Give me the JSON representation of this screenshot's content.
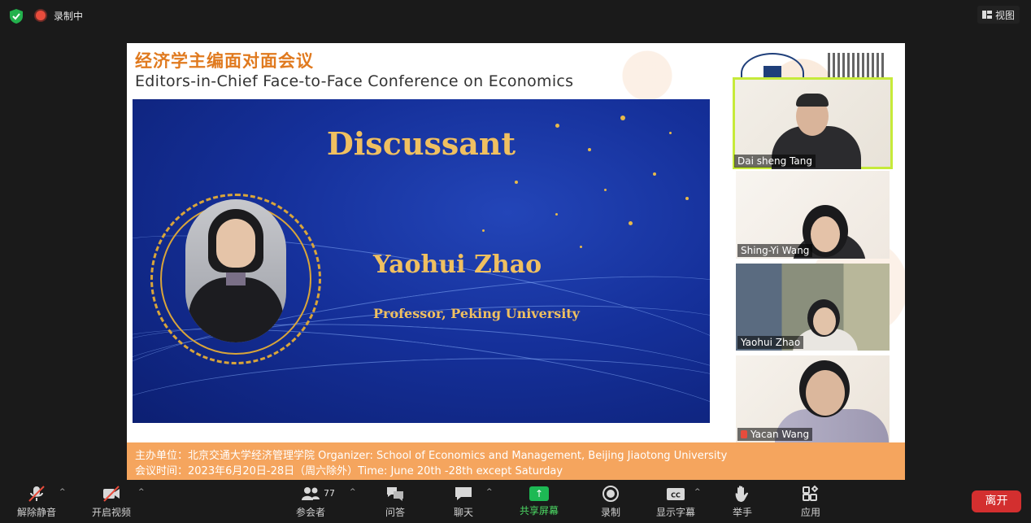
{
  "status": {
    "recording_label": "录制中",
    "view_label": "视图"
  },
  "slide": {
    "title_cn": "经济学主编面对面会议",
    "title_en": "Editors-in-Chief Face-to-Face Conference on Economics",
    "heading": "Discussant",
    "speaker_name": "Yaohui Zhao",
    "speaker_affiliation": "Professor, Peking University",
    "footer_line1": "主办单位：北京交通大学经济管理学院 Organizer: School of Economics and Management, Beijing Jiaotong University",
    "footer_line2": "会议时间：2023年6月20日-28日（周六除外）Time: June 20th -28th except Saturday"
  },
  "participants": [
    {
      "name": "Dai sheng Tang",
      "active": true,
      "muted": false
    },
    {
      "name": "Shing-Yi Wang",
      "active": false,
      "muted": false
    },
    {
      "name": "Yaohui Zhao",
      "active": false,
      "muted": false
    },
    {
      "name": "Yacan Wang",
      "active": false,
      "muted": true
    }
  ],
  "toolbar": {
    "unmute": "解除静音",
    "start_video": "开启视频",
    "participants": "参会者",
    "participant_count": "77",
    "qa": "问答",
    "chat": "聊天",
    "share_screen": "共享屏幕",
    "record": "录制",
    "captions": "显示字幕",
    "raise_hand": "举手",
    "apps": "应用",
    "leave": "离开"
  },
  "colors": {
    "accent_green": "#1db954",
    "leave_red": "#d32f2f",
    "slide_orange": "#e07a1f",
    "active_speaker": "#c6ea3a"
  }
}
